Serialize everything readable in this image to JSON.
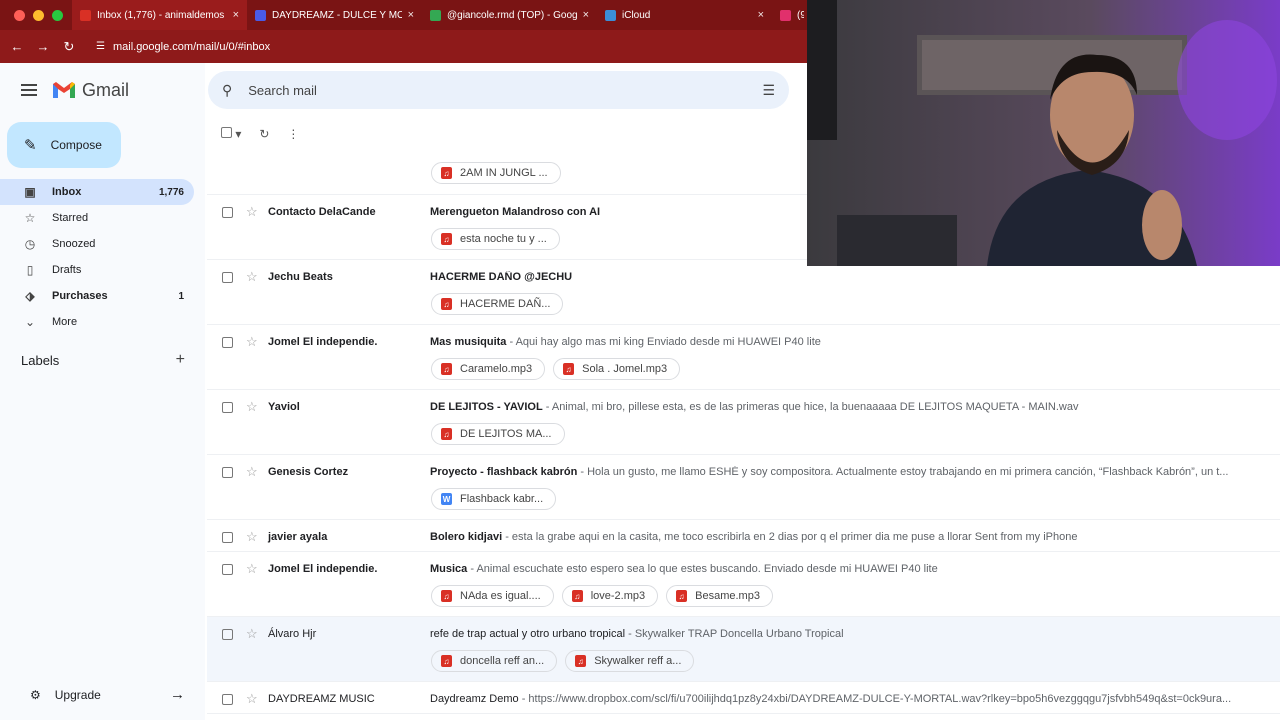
{
  "browser": {
    "tabs": [
      {
        "title": "Inbox (1,776) - animaldemos",
        "favicon_color": "#d93025",
        "active": true
      },
      {
        "title": "DAYDREAMZ - DULCE Y MOR",
        "favicon_color": "#4a5be6",
        "active": false
      },
      {
        "title": "@giancole.rmd (TOP) - Goog",
        "favicon_color": "#34a853",
        "active": false
      },
      {
        "title": "iCloud",
        "favicon_color": "#3b8ed8",
        "active": false
      },
      {
        "title": "(9)",
        "favicon_color": "#e1306c",
        "active": false
      }
    ],
    "url": "mail.google.com/mail/u/0/#inbox"
  },
  "gmail": {
    "logo_text": "Gmail",
    "compose_label": "Compose",
    "search_placeholder": "Search mail",
    "nav": [
      {
        "label": "Inbox",
        "count": "1,776",
        "icon": "inbox-icon",
        "active": true
      },
      {
        "label": "Starred",
        "count": "",
        "icon": "star-icon"
      },
      {
        "label": "Snoozed",
        "count": "",
        "icon": "clock-icon"
      },
      {
        "label": "Drafts",
        "count": "",
        "icon": "draft-icon"
      },
      {
        "label": "Purchases",
        "count": "1",
        "icon": "tag-icon",
        "bold": true
      },
      {
        "label": "More",
        "count": "",
        "icon": "chevron-down-icon"
      }
    ],
    "labels_heading": "Labels",
    "upgrade_label": "Upgrade"
  },
  "emails": [
    {
      "sender": "",
      "subject": "",
      "snippet": "",
      "attachments": [
        {
          "name": "2AM IN JUNGL ...",
          "type": "audio"
        }
      ]
    },
    {
      "sender": "Contacto DelaCande",
      "subject": "Merengueton Malandroso con AI",
      "snippet": "",
      "attachments": [
        {
          "name": "esta noche tu y ...",
          "type": "audio"
        }
      ]
    },
    {
      "sender": "Jechu Beats",
      "subject": "HACERME DAÑO @JECHU",
      "snippet": "",
      "attachments": [
        {
          "name": "HACERME DAÑ...",
          "type": "audio"
        }
      ]
    },
    {
      "sender": "Jomel El independie.",
      "subject": "Mas musiquita",
      "snippet": " - Aqui hay algo mas mi king Enviado desde mi HUAWEI P40 lite",
      "attachments": [
        {
          "name": "Caramelo.mp3",
          "type": "audio"
        },
        {
          "name": "Sola . Jomel.mp3",
          "type": "audio"
        }
      ]
    },
    {
      "sender": "Yaviol",
      "subject": "DE LEJITOS - YAVIOL",
      "snippet": " - Animal, mi bro, pillese esta, es de las primeras que hice, la buenaaaaa DE LEJITOS MAQUETA - MAIN.wav",
      "attachments": [
        {
          "name": "DE LEJITOS MA...",
          "type": "audio"
        }
      ]
    },
    {
      "sender": "Genesis Cortez",
      "subject": "Proyecto - flashback kabrón",
      "snippet": " - Hola un gusto, me llamo ESHÉ y soy compositora. Actualmente estoy trabajando en mi primera canción, “Flashback Kabrón”, un t...",
      "attachments": [
        {
          "name": "Flashback kabr...",
          "type": "doc"
        }
      ]
    },
    {
      "sender": "javier ayala",
      "subject": "Bolero kidjavi",
      "snippet": " - esta la grabe aqui en la casita, me toco escribirla en 2 dias por q el primer dia me puse a llorar Sent from my iPhone",
      "attachments": []
    },
    {
      "sender": "Jomel El independie.",
      "subject": "Musica",
      "snippet": " - Animal escuchate esto espero sea lo que estes buscando. Enviado desde mi HUAWEI P40 lite",
      "attachments": [
        {
          "name": "NAda es igual....",
          "type": "audio"
        },
        {
          "name": "love-2.mp3",
          "type": "audio"
        },
        {
          "name": "Besame.mp3",
          "type": "audio"
        }
      ]
    },
    {
      "sender": "Álvaro Hjr",
      "subject": "refe de trap actual y otro urbano tropical",
      "snippet": " - Skywalker TRAP Doncella Urbano Tropical",
      "read": true,
      "attachments": [
        {
          "name": "doncella reff an...",
          "type": "audio"
        },
        {
          "name": "Skywalker reff a...",
          "type": "audio"
        }
      ]
    },
    {
      "sender": "DAYDREAMZ MUSIC",
      "subject": "Daydreamz Demo",
      "snippet": " - https://www.dropbox.com/scl/fi/u700ilijhdq1pz8y24xbi/DAYDREAMZ-DULCE-Y-MORTAL.wav?rlkey=bpo5h6vezggqgu7jsfvbh549q&st=0ck9ura...",
      "read": true,
      "attachments": []
    }
  ],
  "colors": {
    "audio_icon": "#d93025",
    "doc_icon": "#4285f4",
    "chrome_bg": "#7a1414"
  }
}
